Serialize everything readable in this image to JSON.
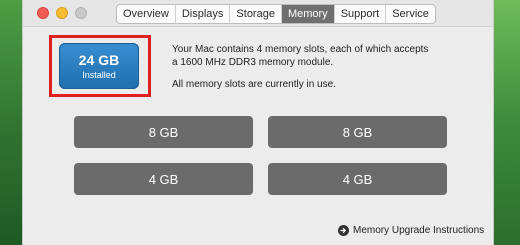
{
  "window": {
    "tabs": [
      {
        "label": "Overview"
      },
      {
        "label": "Displays"
      },
      {
        "label": "Storage"
      },
      {
        "label": "Memory"
      },
      {
        "label": "Support"
      },
      {
        "label": "Service"
      }
    ],
    "active_tab": "Memory"
  },
  "memory": {
    "installed_amount": "24 GB",
    "installed_label": "Installed",
    "description_line1": "Your Mac contains 4 memory slots, each of which accepts",
    "description_line2": "a 1600 MHz DDR3 memory module.",
    "status": "All memory slots are currently in use.",
    "slots": [
      {
        "size": "8 GB"
      },
      {
        "size": "8 GB"
      },
      {
        "size": "4 GB"
      },
      {
        "size": "4 GB"
      }
    ],
    "upgrade_link": "Memory Upgrade Instructions"
  },
  "colors": {
    "installed_button": "#2a7fc4",
    "slot_fill": "#6b6b6b",
    "highlight_border": "#e02020",
    "active_tab": "#6f6f6f"
  },
  "icons": {
    "upgrade_link_icon": "arrow-circle-right-icon"
  }
}
